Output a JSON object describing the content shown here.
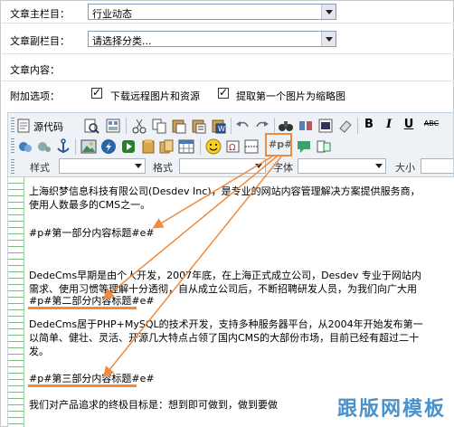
{
  "form": {
    "main_column_label": "文章主栏目：",
    "main_column_value": "行业动态",
    "sub_column_label": "文章副栏目：",
    "sub_column_value": "请选择分类...",
    "content_label": "文章内容：",
    "options_label": "附加选项：",
    "option_download_label": "下载远程图片和资源",
    "option_download_checked": true,
    "option_thumb_label": "提取第一个图片为缩略图",
    "option_thumb_checked": true
  },
  "toolbar": {
    "source_label": "源代码",
    "pagebreak_label": "#p#",
    "style_label": "样式",
    "format_label": "格式",
    "font_label": "字体",
    "size_label": "大小",
    "bold": "B",
    "italic": "I",
    "underline": "U",
    "strike": "ABC"
  },
  "editor": {
    "para1_line1": "上海织梦信息科技有限公司(Desdev Inc)，是专业的网站内容管理解决方案提供服务商，",
    "para1_line2": "使用人数最多的CMS之一。",
    "heading1": "#p#第一部分内容标题#e#",
    "para2_line1": "DedeCms早期是由个人开发，2007年底，在上海正式成立公司，Desdev 专业于网站内",
    "para2_line2": "需求、使用习惯等理解十分透彻，自从成立公司后，不断招聘研发人员，为我们向广大用",
    "heading2": "#p#第二部分内容标题#e#",
    "para3_line1": "DedeCms居于PHP+MySQL的技术开发，支持多种服务器平台，从2004年开始发布第一",
    "para3_line2": "以简单、健壮、灵活、开源几大特点占领了国内CMS的大部份市场，目前已经有超过二十",
    "para3_line3": "发。",
    "heading3": "#p#第三部分内容标题#e#",
    "para4_line1": "我们对产品追求的终极目标是：想到即可做到，做到要做"
  },
  "watermark": "跟版网模板",
  "colors": {
    "accent": "#f08a3c",
    "watermark": "#2d7fc1"
  }
}
